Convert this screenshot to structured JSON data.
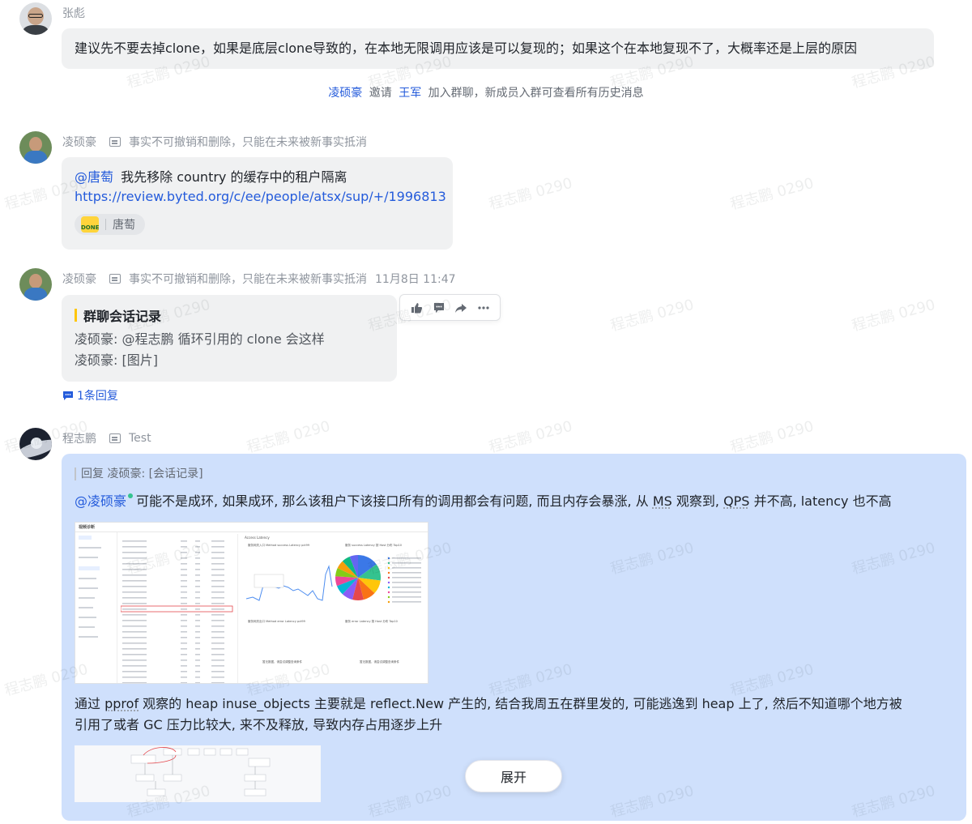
{
  "messages": [
    {
      "sender": "张彪",
      "text": "建议先不要去掉clone，如果是底层clone导致的，在本地无限调用应该是可以复现的；如果这个在本地复现不了，大概率还是上层的原因"
    },
    {
      "system": {
        "actor": "凌硕豪",
        "verb": "邀请",
        "target": "王军",
        "rest": "加入群聊，新成员入群可查看所有历史消息"
      }
    },
    {
      "sender": "凌硕豪",
      "signature": "事实不可撤销和删除，只能在未来被新事实抵消",
      "mention": "@唐萄",
      "text": "我先移除 country 的缓存中的租户隔离",
      "link": "https://review.byted.org/c/ee/people/atsx/sup/+/1996813",
      "reaction_badge": "DONE",
      "reaction_user": "唐萄"
    },
    {
      "sender": "凌硕豪",
      "signature": "事实不可撤销和删除，只能在未来被新事实抵消",
      "time": "11月8日 11:47",
      "card_title": "群聊会话记录",
      "card_lines": [
        "凌硕豪: @程志鹏 循环引用的 clone 会这样",
        "凌硕豪: [图片]"
      ],
      "reply_count": "1条回复"
    },
    {
      "sender": "程志鹏",
      "signature": "Test",
      "quote": "回复 凌硕豪: [会话记录]",
      "mention": "@凌硕豪",
      "text_a": "可能不是成环, 如果成环, 那么该租户下该接口所有的调用都会有问题, 而且内存会暴涨, 从",
      "term_ms": "MS",
      "text_b": "观察到,",
      "term_qps": "QPS",
      "text_c": "并不高, latency 也不高",
      "para2_a": "通过",
      "term_pprof": "pprof",
      "para2_b": "观察的 heap inuse_objects 主要就是 reflect.New 产生的, 结合我周五在群里发的, 可能逃逸到 heap 上了, 然后不知道哪个地方被",
      "para2_line2": "引用了或者 GC 压力比较大, 来不及释放, 导致内存占用逐步上升",
      "expand_label": "展开"
    }
  ],
  "watermark": "程志鹏 0290",
  "colors": {
    "bubble": "#f0f1f2",
    "highlight": "#cfe0fc",
    "link": "#245bdb",
    "card_accent": "#ffc60a"
  },
  "screenshot": {
    "sidebar_title": "视频诊断",
    "panel_title": "Access Latency",
    "sections": [
      "服务网关入口 Method success Latency pct99",
      "服务 success Latency 按 Host 分布 Top10",
      "服务网关出口 Method error Latency pct99",
      "服务 error Latency 按 Host 分布 Top10"
    ],
    "empty_note": "暂无数据，请尝试调整查询条件",
    "pie_values": [
      15,
      12,
      10,
      9,
      8,
      8,
      7,
      7,
      6,
      6,
      6,
      6
    ]
  }
}
